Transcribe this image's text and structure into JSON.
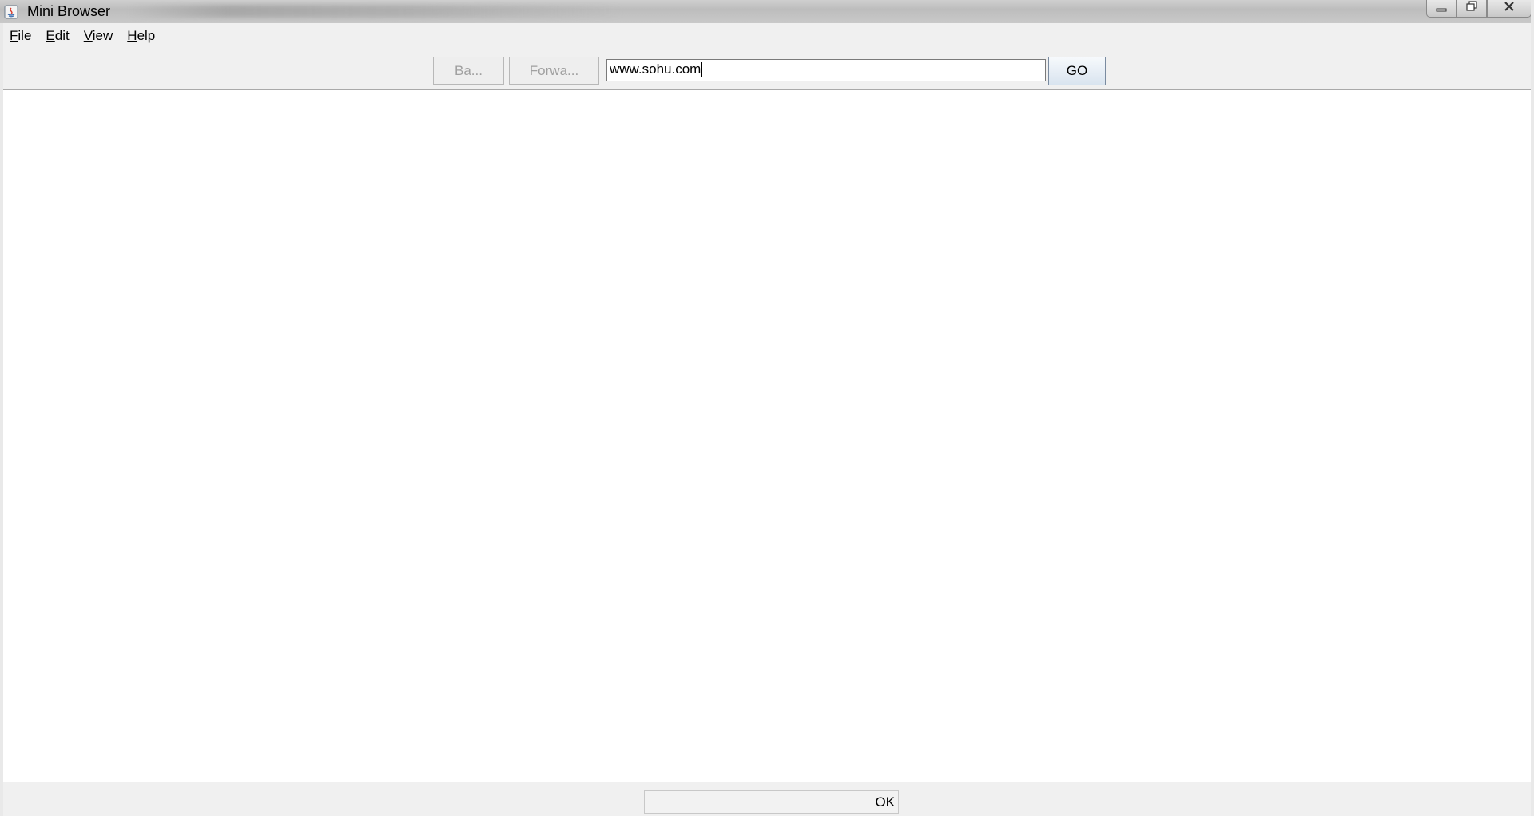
{
  "window": {
    "title": "Mini Browser"
  },
  "menubar": {
    "items": [
      {
        "label": "File",
        "mnemonic": "F",
        "rest": "ile"
      },
      {
        "label": "Edit",
        "mnemonic": "E",
        "rest": "dit"
      },
      {
        "label": "View",
        "mnemonic": "V",
        "rest": "iew"
      },
      {
        "label": "Help",
        "mnemonic": "H",
        "rest": "elp"
      }
    ]
  },
  "toolbar": {
    "back_label": "Ba...",
    "forward_label": "Forwa...",
    "url_value": "www.sohu.com",
    "go_label": "GO"
  },
  "statusbar": {
    "status_text": "OK"
  },
  "colors": {
    "accent": "#d9e4ef",
    "disabled_text": "#a0a0a0",
    "chrome": "#f0f0f0"
  },
  "icons": [
    "java-app-icon",
    "minimize-icon",
    "restore-icon",
    "close-icon"
  ]
}
